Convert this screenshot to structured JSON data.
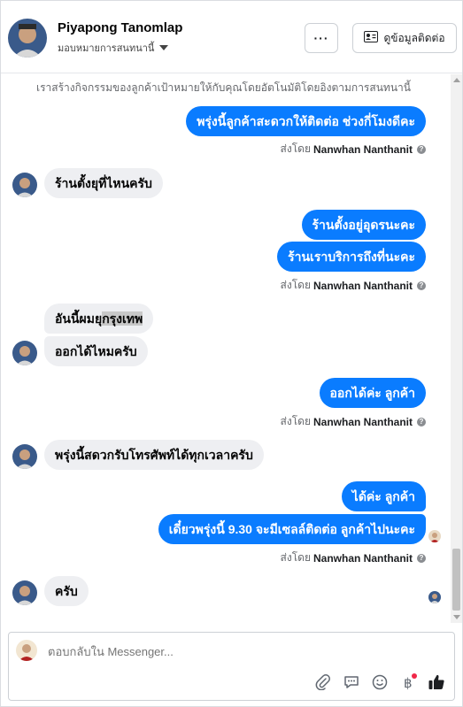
{
  "header": {
    "name": "Piyapong Tanomlap",
    "assign_label": "มอบหมายการสนทนานี้",
    "more_label": "···",
    "contact_label": "ดูข้อมูลติดต่อ"
  },
  "notice": "เราสร้างกิจกรรมของลูกค้าเป้าหมายให้กับคุณโดยอัตโนมัติโดยอิงตามการสนทนานี้",
  "sent_by_prefix": "ส่งโดย",
  "agent_name": "Nanwhan Nanthanit",
  "messages": {
    "m1": "พรุ่งนี้ลูกค้าสะดวกให้ติดต่อ ช่วงกี่โมงดีคะ",
    "m2": "ร้านตั้งยุที่ไหนครับ",
    "m3": "ร้านตั้งอยู่อุดรนะคะ",
    "m4": "ร้านเราบริการถึงที่นะคะ",
    "m5a": "อันนี้ผมยุ",
    "m5b": "กรุงเทพ",
    "m6": "ออกได้ไหมครับ",
    "m7": "ออกได้ค่ะ ลูกค้า",
    "m8": "พรุ่งนี้สดวกรับโทรศัพท์ได้ทุกเวลาครับ",
    "m9": "ได้ค่ะ ลูกค้า",
    "m10": "เดี๋ยวพรุ่งนี้ 9.30 จะมีเซลล์ติดต่อ ลูกค้าไปนะคะ",
    "m11": "ครับ"
  },
  "composer": {
    "placeholder": "ตอบกลับใน Messenger..."
  },
  "colors": {
    "outgoing": "#0a7cff",
    "incoming": "#eeeff2",
    "like": "#1c1e21"
  }
}
